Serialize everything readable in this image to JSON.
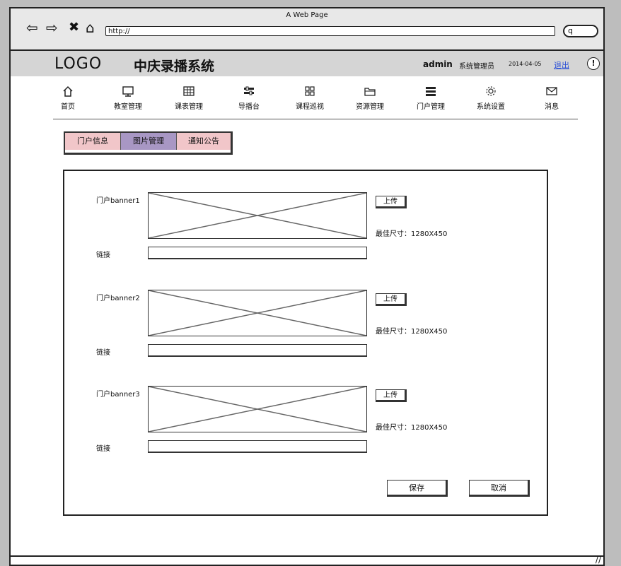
{
  "browser": {
    "page_title": "A Web Page",
    "url": "http://"
  },
  "header": {
    "logo": "LOGO",
    "system_title": "中庆录播系统",
    "username": "admin",
    "role": "系统管理员",
    "date": "2014-04-05",
    "logout": "退出"
  },
  "nav": {
    "items": [
      {
        "label": "首页",
        "icon": "home-icon"
      },
      {
        "label": "教室管理",
        "icon": "monitor-icon"
      },
      {
        "label": "课表管理",
        "icon": "table-icon"
      },
      {
        "label": "导播台",
        "icon": "director-icon"
      },
      {
        "label": "课程巡视",
        "icon": "grid-icon"
      },
      {
        "label": "资源管理",
        "icon": "folder-icon"
      },
      {
        "label": "门户管理",
        "icon": "menu-icon"
      },
      {
        "label": "系统设置",
        "icon": "gear-icon"
      },
      {
        "label": "消息",
        "icon": "mail-icon"
      }
    ]
  },
  "tabs": [
    {
      "label": "门户信息",
      "active": false
    },
    {
      "label": "图片管理",
      "active": true
    },
    {
      "label": "通知公告",
      "active": false
    }
  ],
  "banners": [
    {
      "label": "门户banner1",
      "upload": "上传",
      "hint": "最佳尺寸：1280X450",
      "link_label": "链接",
      "link_value": ""
    },
    {
      "label": "门户banner2",
      "upload": "上传",
      "hint": "最佳尺寸：1280X450",
      "link_label": "链接",
      "link_value": ""
    },
    {
      "label": "门户banner3",
      "upload": "上传",
      "hint": "最佳尺寸：1280X450",
      "link_label": "链接",
      "link_value": ""
    }
  ],
  "actions": {
    "save": "保存",
    "cancel": "取消"
  }
}
